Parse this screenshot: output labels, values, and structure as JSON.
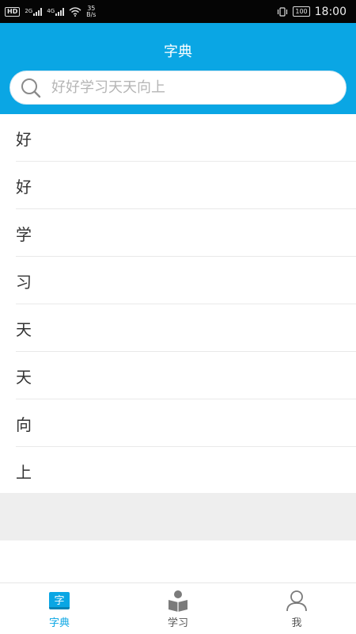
{
  "status_bar": {
    "hd_badge": "HD",
    "net_2g": "2G",
    "net_4g": "4G",
    "speed_value": "35",
    "speed_unit": "B/s",
    "battery": "100",
    "time": "18:00"
  },
  "header": {
    "title": "字典"
  },
  "search": {
    "placeholder": "好好学习天天向上",
    "value": ""
  },
  "characters": [
    "好",
    "好",
    "学",
    "习",
    "天",
    "天",
    "向",
    "上"
  ],
  "tabbar": {
    "active": "dictionary",
    "dictionary_icon_char": "字",
    "tabs": [
      "字典",
      "学习",
      "我"
    ]
  },
  "colors": {
    "accent": "#0aa6e4",
    "status_bar_bg": "#050505",
    "divider": "#e9e9e9",
    "gray_band": "#eeeeee"
  }
}
